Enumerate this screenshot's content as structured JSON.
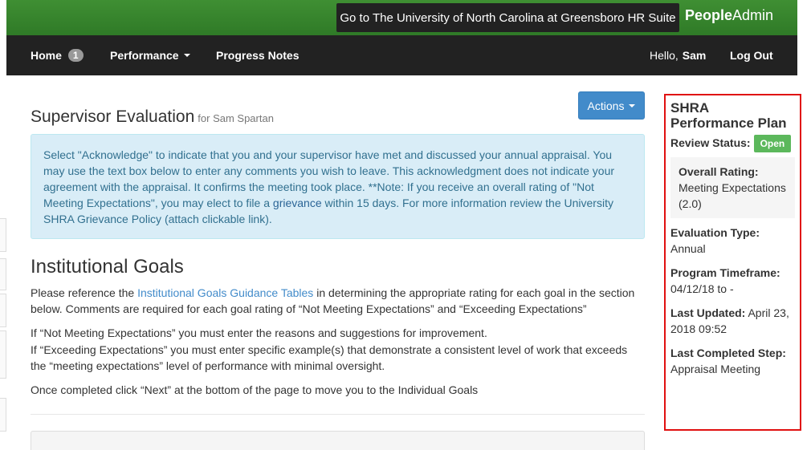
{
  "header": {
    "suite_button": "Go to The University of North Carolina at Greensboro HR Suite",
    "brand_bold": "People",
    "brand_rest": "Admin"
  },
  "nav": {
    "home": "Home",
    "home_badge": "1",
    "performance": "Performance",
    "progress_notes": "Progress Notes",
    "hello": "Hello,",
    "user": "Sam",
    "logout": "Log Out"
  },
  "main": {
    "actions": "Actions",
    "title": "Supervisor Evaluation",
    "title_for": "for Sam Spartan",
    "info": {
      "part1": "Select \"Acknowledge\" to indicate that you and your supervisor have met and discussed your annual appraisal. You may use the text box below to enter any comments you wish to leave. This acknowledgment does not indicate your agreement with the appraisal. It confirms the meeting took place. **Note: If you receive an overall rating of \"Not Meeting Expectations\", you may elect to file a ",
      "link": "grievance",
      "part2": " within 15 days. For more information review the University SHRA Grievance Policy (attach clickable link)."
    },
    "section_title": "Institutional Goals",
    "p1_pre": "Please reference the ",
    "p1_link": "Institutional Goals Guidance Tables",
    "p1_post": " in determining the appropriate rating for each goal in the section below. Comments are required for each goal rating of “Not Meeting Expectations” and “Exceeding Expectations”",
    "p2": "If “Not Meeting Expectations” you must enter the reasons and suggestions for improvement.",
    "p3": "If “Exceeding Expectations” you must enter specific example(s) that demonstrate a consistent level of work that exceeds the “meeting expectations” level of performance with minimal oversight.",
    "p4": "Once completed click “Next” at the bottom of the page to move you to the Individual Goals"
  },
  "sidebar": {
    "title": "SHRA Performance Plan",
    "review_status_label": "Review Status:",
    "review_status": "Open",
    "overall_rating_label": "Overall Rating:",
    "overall_rating": "Meeting Expectations (2.0)",
    "evaluation_type_label": "Evaluation Type:",
    "evaluation_type": "Annual",
    "program_timeframe_label": "Program Timeframe:",
    "program_timeframe": "04/12/18 to -",
    "last_updated_label": "Last Updated:",
    "last_updated": "April 23, 2018 09:52",
    "last_completed_label": "Last Completed Step:",
    "last_completed": "Appraisal Meeting"
  },
  "colors": {
    "topbar_green": "#3f8f33",
    "navbar_dark": "#222222",
    "primary_blue": "#428bca",
    "success_green": "#5cb85c",
    "highlight_red": "#e01010"
  }
}
